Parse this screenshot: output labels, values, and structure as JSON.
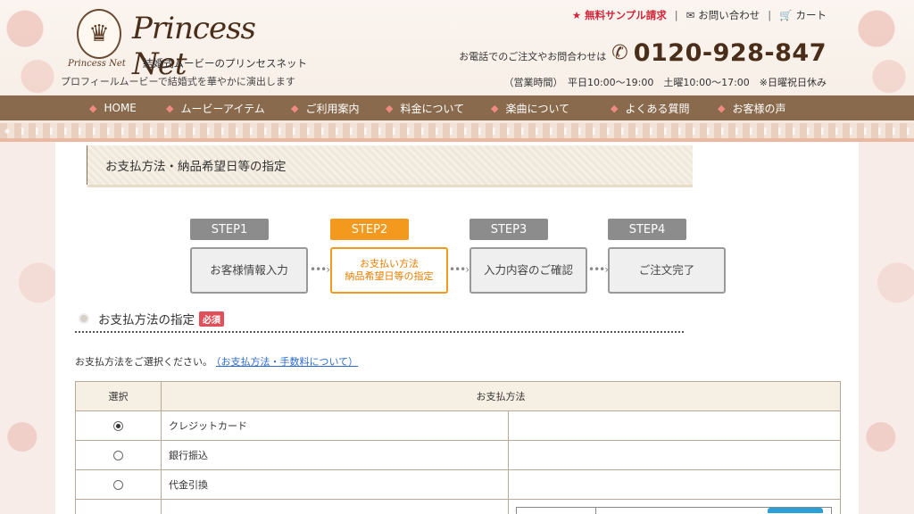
{
  "header": {
    "logo_small": "Princess Net",
    "logo_script": "Princess Net",
    "logo_sub": "結婚式ムービーのプリンセスネット",
    "tagline": "プロフィールムービーで結婚式を華やかに演出します",
    "toplinks": {
      "sample": "無料サンプル請求",
      "contact": "お問い合わせ",
      "cart": "カート"
    },
    "phone_label": "お電話でのご注文やお問合わせは",
    "phone_number": "0120-928-847",
    "hours": "（営業時間）　平日10:00～19:00　土曜10:00～17:00　※日曜祝日休み"
  },
  "nav": {
    "items": [
      {
        "label": "HOME"
      },
      {
        "label": "ムービーアイテム"
      },
      {
        "label": "ご利用案内"
      },
      {
        "label": "料金について"
      },
      {
        "label": "楽曲について"
      },
      {
        "label": "よくある質問"
      },
      {
        "label": "お客様の声"
      }
    ]
  },
  "main": {
    "section_title": "お支払方法・納品希望日等の指定",
    "steps": [
      {
        "tab": "STEP1",
        "label": "お客様情報入力"
      },
      {
        "tab": "STEP2",
        "label_line1": "お支払い方法",
        "label_line2": "納品希望日等の指定"
      },
      {
        "tab": "STEP3",
        "label": "入力内容のご確認"
      },
      {
        "tab": "STEP4",
        "label": "ご注文完了"
      }
    ],
    "step_arrow": "•••›",
    "payment_title": "お支払方法の指定",
    "required_badge": "必須",
    "instruction": "お支払方法をご選択ください。",
    "instruction_link": "（お支払方法・手数料について）",
    "table": {
      "col_select": "選択",
      "col_method": "お支払方法",
      "rows": [
        {
          "method": "クレジットカード",
          "checked": true
        },
        {
          "method": "銀行振込",
          "checked": false
        },
        {
          "method": "代金引換",
          "checked": false
        }
      ]
    }
  },
  "icons": {
    "star": "★",
    "mail": "✉",
    "cart": "🛒",
    "phone": "✆",
    "nav_bullet": "◆",
    "crown": "♛"
  },
  "colors": {
    "nav_bg": "#8a6a4c",
    "accent_active": "#f39a1e",
    "required": "#e0505a",
    "link": "#2a6ad0"
  }
}
